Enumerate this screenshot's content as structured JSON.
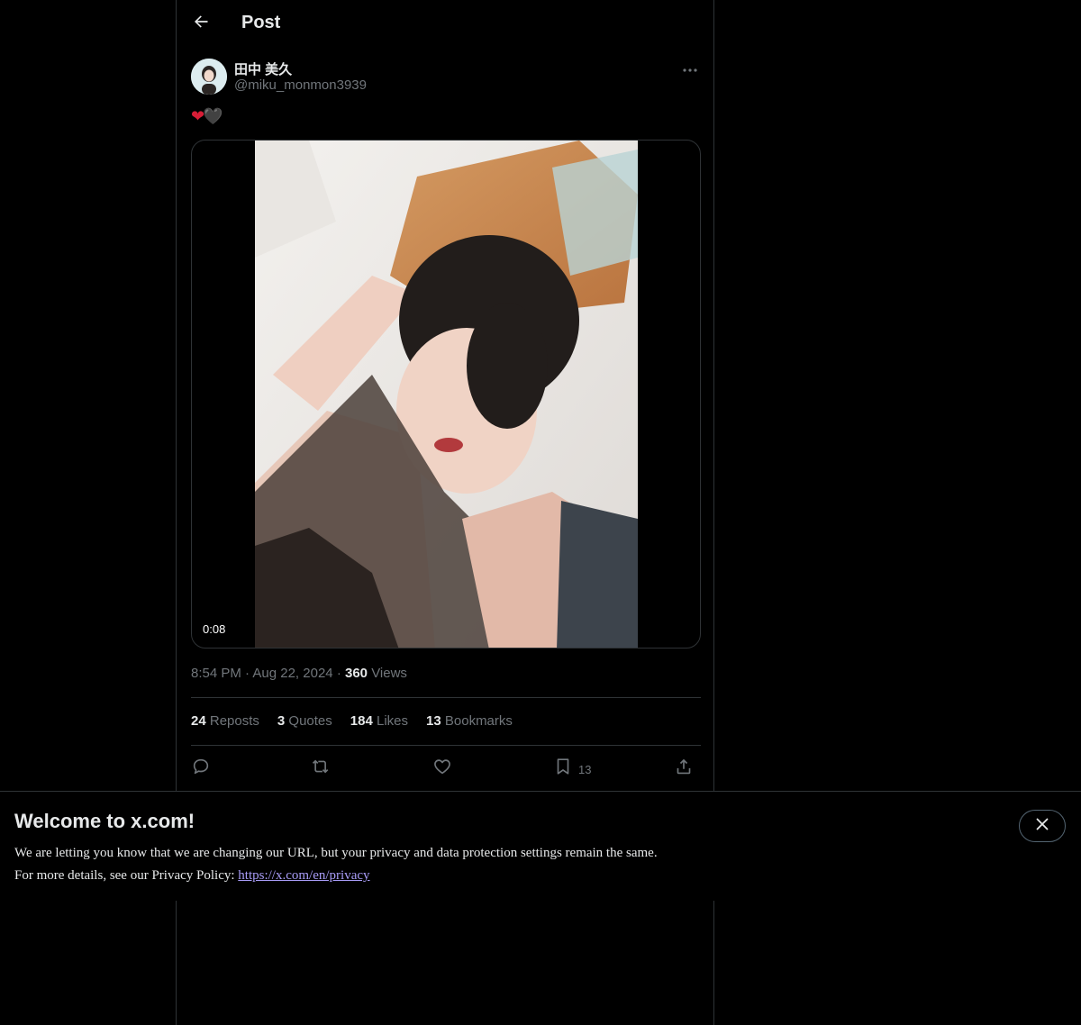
{
  "header": {
    "title": "Post",
    "back_icon": "arrow-left-icon"
  },
  "author": {
    "display_name": "田中 美久",
    "handle": "@miku_monmon3939",
    "more_icon": "more-horizontal-icon"
  },
  "post": {
    "text_emoji": [
      "❤",
      "🖤"
    ],
    "video": {
      "duration": "0:08"
    },
    "time": "8:54 PM",
    "date": "Aug 22, 2024",
    "views_count": "360",
    "views_label": "Views",
    "separator": "·"
  },
  "stats": {
    "reposts_count": "24",
    "reposts_label": "Reposts",
    "quotes_count": "3",
    "quotes_label": "Quotes",
    "likes_count": "184",
    "likes_label": "Likes",
    "bookmarks_count": "13",
    "bookmarks_label": "Bookmarks"
  },
  "actions": {
    "reply_icon": "reply-icon",
    "repost_icon": "repost-icon",
    "like_icon": "heart-icon",
    "bookmark_icon": "bookmark-icon",
    "bookmark_count": "13",
    "share_icon": "share-icon"
  },
  "banner": {
    "title": "Welcome to x.com!",
    "line1": "We are letting you know that we are changing our URL, but your privacy and data protection settings remain the same.",
    "line2_prefix": "For more details, see our Privacy Policy: ",
    "link_text": "https://x.com/en/privacy",
    "close_icon": "close-icon"
  },
  "colors": {
    "background": "#000000",
    "text_primary": "#e7e9ea",
    "text_secondary": "#71767b",
    "border": "#2f3336",
    "link": "#a89cf7",
    "heart_red": "#d71d36"
  }
}
